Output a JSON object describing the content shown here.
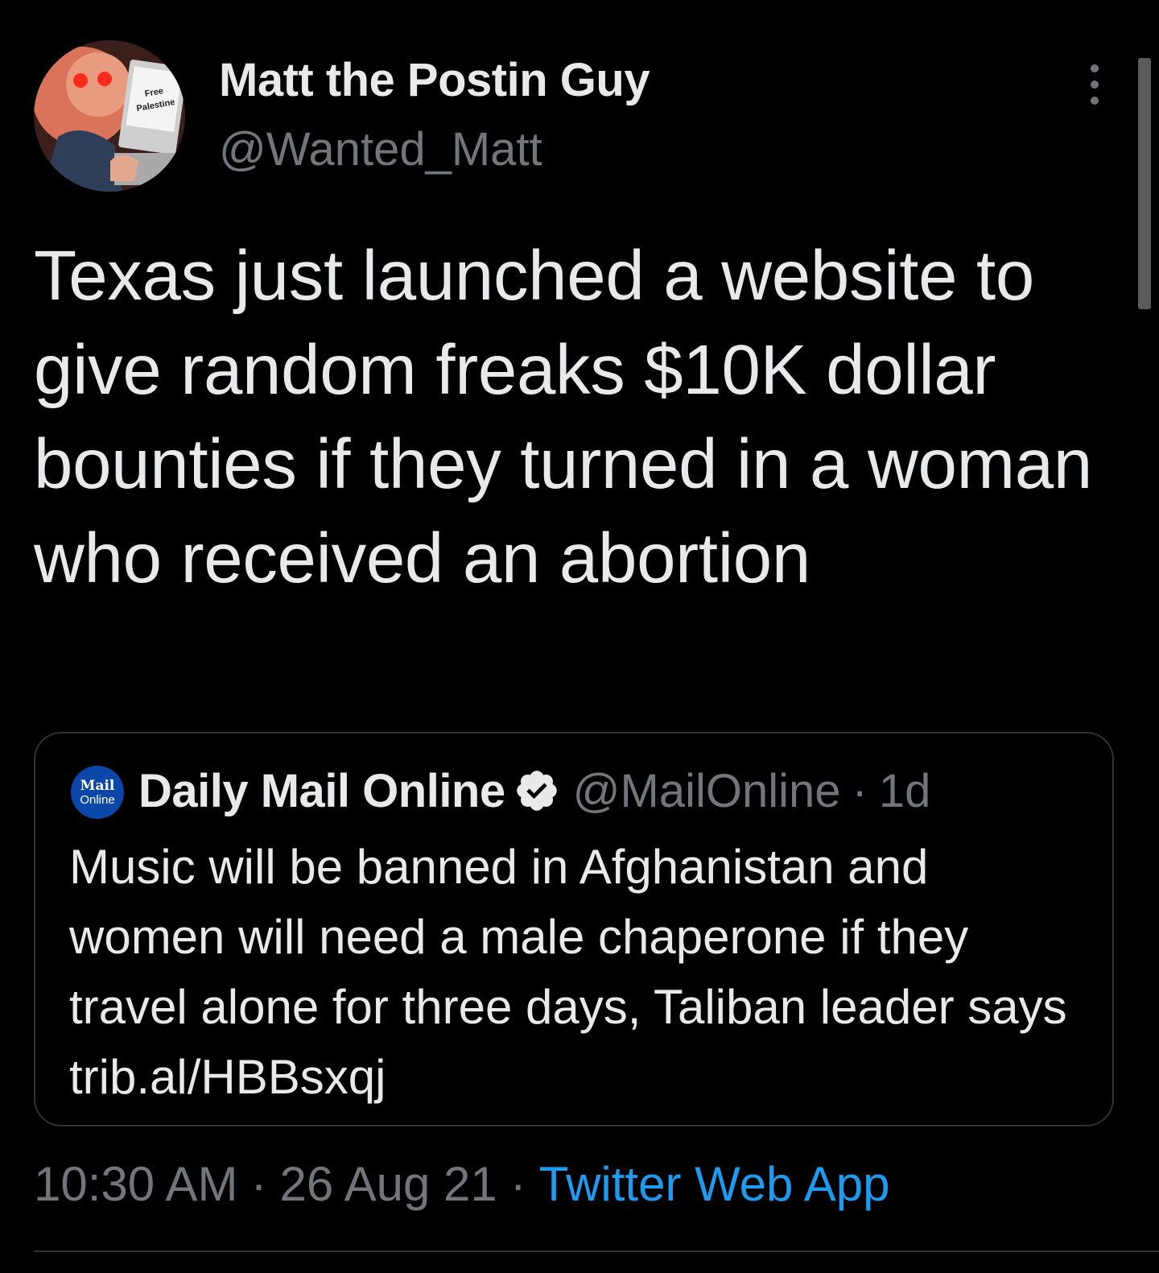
{
  "tweet": {
    "author": {
      "display_name": "Matt the Postin Guy",
      "handle": "@Wanted_Matt",
      "avatar_sign_text": "Free Palestine"
    },
    "text": "Texas just launched a website to give random freaks $10K dollar bounties if they turned in a woman who received an abortion",
    "quoted": {
      "avatar_line1": "Mail",
      "avatar_line2": "Online",
      "display_name": "Daily Mail Online",
      "handle": "@MailOnline",
      "separator": "·",
      "time": "1d",
      "text": "Music will be banned in Afghanistan and women will need a male chaperone if they travel alone for three days, Taliban leader says trib.al/HBBsxqj"
    },
    "meta": {
      "time": "10:30 AM",
      "separator": "·",
      "date": "26 Aug 21",
      "source": "Twitter Web App"
    }
  },
  "colors": {
    "background": "#000000",
    "primary_text": "#e7e9ea",
    "secondary_text": "#71767b",
    "link": "#1d9bf0",
    "border": "#2f3336",
    "mail_online_blue": "#0a47a9"
  },
  "icons": [
    "more-options-icon",
    "verified-badge-icon"
  ]
}
